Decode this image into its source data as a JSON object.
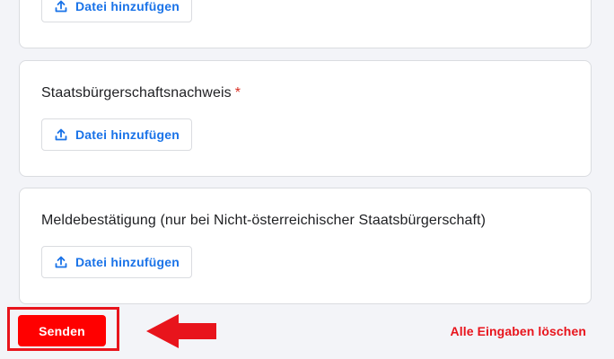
{
  "colors": {
    "accent": "#1a73e8",
    "brand": "#ff0000",
    "required": "#d93025",
    "highlight": "#e8141c",
    "background": "#f3f4f8"
  },
  "upload_cards": [
    {
      "question": "",
      "required_mark": "",
      "button_label": "Datei hinzufügen",
      "button_icon": "upload-icon"
    },
    {
      "question": "Staatsbürgerschaftsnachweis",
      "required_mark": "*",
      "button_label": "Datei hinzufügen",
      "button_icon": "upload-icon"
    },
    {
      "question": "Meldebestätigung (nur bei Nicht-österreichischer Staatsbürgerschaft)",
      "required_mark": "",
      "button_label": "Datei hinzufügen",
      "button_icon": "upload-icon"
    }
  ],
  "actions": {
    "submit_label": "Senden",
    "clear_label": "Alle Eingaben löschen"
  },
  "annotation": {
    "highlight": "red-box-around-submit",
    "pointer": "red-arrow-pointing-left"
  }
}
